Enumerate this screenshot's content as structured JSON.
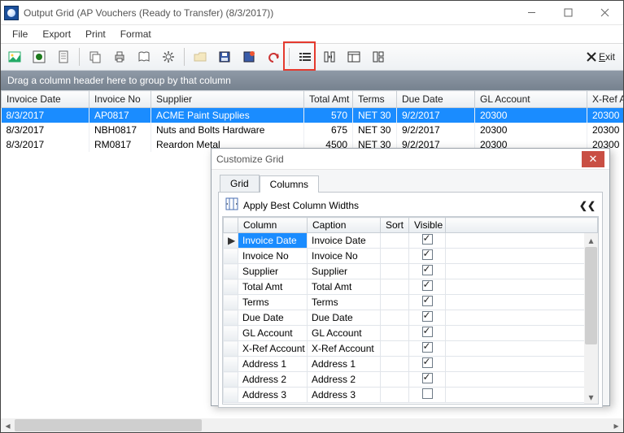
{
  "window": {
    "title": "Output Grid (AP Vouchers (Ready to Transfer) (8/3/2017))"
  },
  "menu": {
    "file": "File",
    "export": "Export",
    "print": "Print",
    "format": "Format"
  },
  "exit_label": "Exit",
  "grouping_hint": "Drag a column header here to group by that column",
  "grid": {
    "headers": {
      "invoice_date": "Invoice Date",
      "invoice_no": "Invoice No",
      "supplier": "Supplier",
      "total_amt": "Total Amt",
      "terms": "Terms",
      "due_date": "Due Date",
      "gl_account": "GL Account",
      "xref": "X-Ref Accou"
    },
    "rows": [
      {
        "invoice_date": "8/3/2017",
        "invoice_no": "AP0817",
        "supplier": "ACME Paint Supplies",
        "total_amt": "570",
        "terms": "NET 30",
        "due_date": "9/2/2017",
        "gl_account": "20300",
        "xref": "20300"
      },
      {
        "invoice_date": "8/3/2017",
        "invoice_no": "NBH0817",
        "supplier": "Nuts and Bolts Hardware",
        "total_amt": "675",
        "terms": "NET 30",
        "due_date": "9/2/2017",
        "gl_account": "20300",
        "xref": "20300"
      },
      {
        "invoice_date": "8/3/2017",
        "invoice_no": "RM0817",
        "supplier": "Reardon Metal",
        "total_amt": "4500",
        "terms": "NET 30",
        "due_date": "9/2/2017",
        "gl_account": "20300",
        "xref": "20300"
      }
    ]
  },
  "dialog": {
    "title": "Customize Grid",
    "tab_grid": "Grid",
    "tab_columns": "Columns",
    "apply_best": "Apply Best Column Widths",
    "headers": {
      "column": "Column",
      "caption": "Caption",
      "sort": "Sort",
      "visible": "Visible"
    },
    "rows": [
      {
        "column": "Invoice Date",
        "caption": "Invoice Date",
        "visible": true,
        "selected": true,
        "marker": "▶"
      },
      {
        "column": "Invoice No",
        "caption": "Invoice No",
        "visible": true
      },
      {
        "column": "Supplier",
        "caption": "Supplier",
        "visible": true
      },
      {
        "column": "Total Amt",
        "caption": "Total Amt",
        "visible": true
      },
      {
        "column": "Terms",
        "caption": "Terms",
        "visible": true
      },
      {
        "column": "Due Date",
        "caption": "Due Date",
        "visible": true
      },
      {
        "column": "GL Account",
        "caption": "GL Account",
        "visible": true
      },
      {
        "column": "X-Ref Account",
        "caption": "X-Ref Account",
        "visible": true
      },
      {
        "column": "Address 1",
        "caption": "Address 1",
        "visible": true
      },
      {
        "column": "Address 2",
        "caption": "Address 2",
        "visible": true
      },
      {
        "column": "Address 3",
        "caption": "Address 3",
        "visible": false
      }
    ]
  }
}
